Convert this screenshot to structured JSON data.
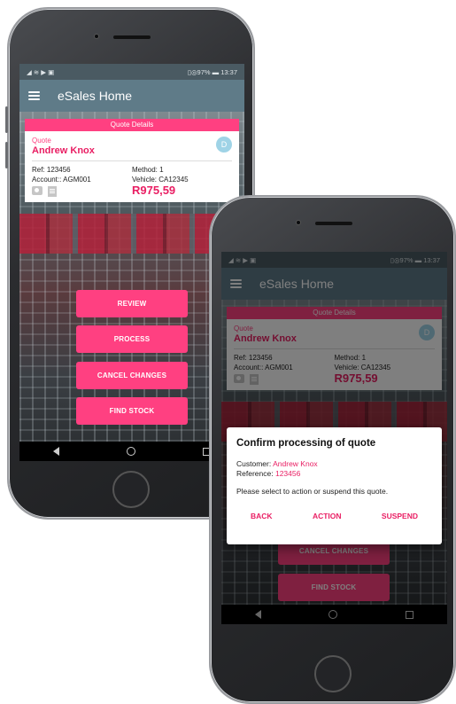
{
  "status_bar": {
    "left": "◢ ≋ ▶ ▣",
    "right": "▯◎97% ▬ 13:37"
  },
  "app": {
    "title": "eSales Home"
  },
  "quote": {
    "section": "Quote Details",
    "label": "Quote",
    "customer": "Andrew Knox",
    "avatar_initial": "D",
    "ref": "Ref: 123456",
    "account": "Account:: AGM001",
    "method": "Method: 1",
    "vehicle": "Vehicle: CA12345",
    "amount": "R975,59"
  },
  "actions": {
    "review": "REVIEW",
    "process": "PROCESS",
    "cancel": "CANCEL CHANGES",
    "find_stock": "FIND STOCK"
  },
  "nav": {
    "back": "◁",
    "home": "○",
    "recent": "□"
  },
  "dialog": {
    "title": "Confirm processing of quote",
    "customer_label": "Customer:",
    "customer_value": "Andrew Knox",
    "reference_label": "Reference:",
    "reference_value": "123456",
    "message": "Please select to action or suspend this quote.",
    "back": "BACK",
    "action": "ACTION",
    "suspend": "SUSPEND"
  },
  "colors": {
    "accent": "#ff4081",
    "appbar": "#5f7b88",
    "status": "#4a5a62"
  }
}
